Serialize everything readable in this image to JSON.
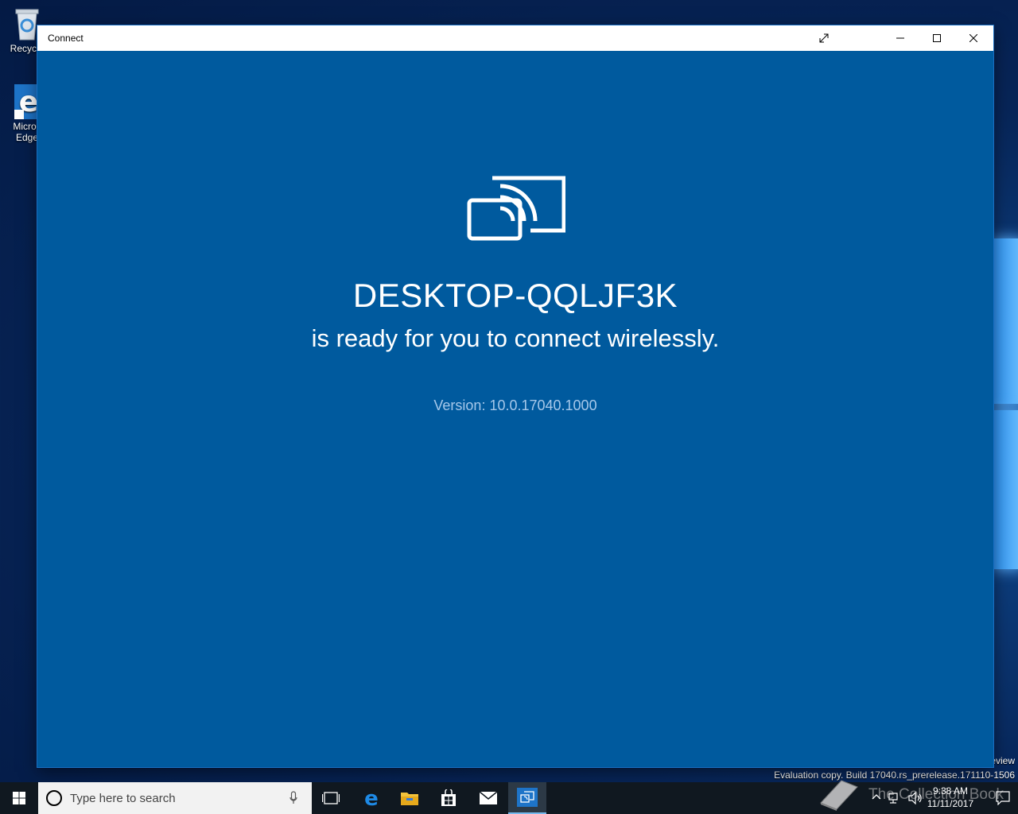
{
  "desktop": {
    "icons": [
      {
        "label": "Recycle"
      },
      {
        "label": "Micros Edge"
      }
    ],
    "watermark_preview": "eview",
    "watermark_build": "Evaluation copy. Build 17040.rs_prerelease.171110-1506",
    "overlay_text": "The Collection Book"
  },
  "window": {
    "title": "Connect",
    "device_name": "DESKTOP-QQLJF3K",
    "ready_text": "is ready for you to connect wirelessly.",
    "version_text": "Version: 10.0.17040.1000",
    "background_color": "#005a9e"
  },
  "taskbar": {
    "search_placeholder": "Type here to search",
    "apps": [
      "task-view",
      "edge",
      "file-explorer",
      "store",
      "mail",
      "connect"
    ],
    "clock_time": "9:38 AM",
    "clock_date": "11/11/2017"
  }
}
